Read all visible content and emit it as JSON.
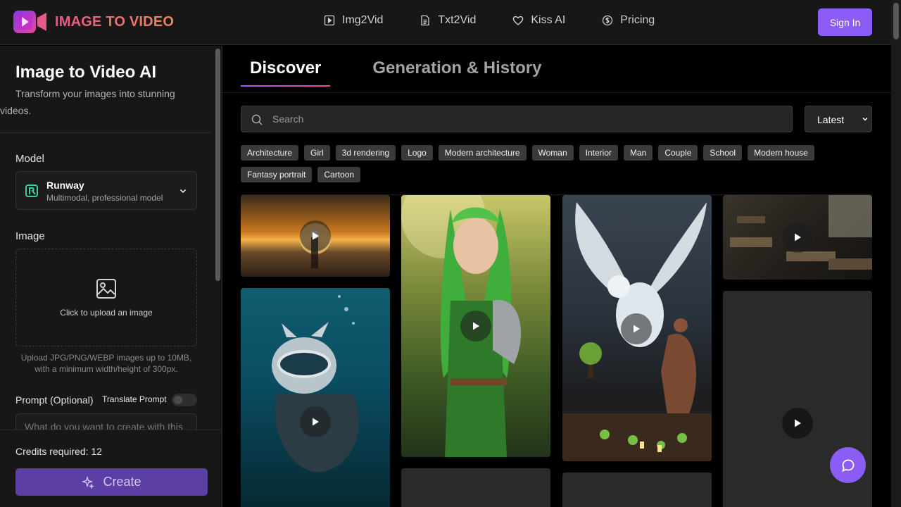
{
  "header": {
    "brand": "IMAGE TO VIDEO",
    "nav": [
      {
        "label": "Img2Vid",
        "icon": "video-icon"
      },
      {
        "label": "Txt2Vid",
        "icon": "document-icon"
      },
      {
        "label": "Kiss AI",
        "icon": "heart-icon"
      },
      {
        "label": "Pricing",
        "icon": "coin-icon"
      }
    ],
    "sign_in": "Sign In"
  },
  "sidebar": {
    "title": "Image to Video AI",
    "description_line1": "Transform your images into stunning",
    "description_line2": "videos.",
    "model_label": "Model",
    "model": {
      "name": "Runway",
      "subtitle": "Multimodal, professional model"
    },
    "image_label": "Image",
    "upload_text": "Click to upload an image",
    "upload_note": "Upload JPG/PNG/WEBP images up to 10MB, with a minimum width/height of 300px.",
    "prompt_label": "Prompt (Optional)",
    "translate_label": "Translate Prompt",
    "translate_enabled": false,
    "prompt_placeholder": "What do you want to create with this image?",
    "credits_text": "Credits required: 12",
    "create_label": "Create"
  },
  "main": {
    "tabs": [
      {
        "label": "Discover",
        "active": true
      },
      {
        "label": "Generation & History",
        "active": false
      }
    ],
    "search_placeholder": "Search",
    "sort_value": "Latest",
    "tags": [
      "Architecture",
      "Girl",
      "3d rendering",
      "Logo",
      "Modern architecture",
      "Woman",
      "Interior",
      "Man",
      "Couple",
      "School",
      "Modern house",
      "Fantasy portrait",
      "Cartoon"
    ],
    "gallery": [
      {
        "subject": "desert-sunset-traveler",
        "has_play": true
      },
      {
        "subject": "diver-cat-underwater",
        "has_play": true
      },
      {
        "subject": "green-haired-elf-warrior",
        "has_play": true
      },
      {
        "subject": "white-eagle-and-warrior-with-tree",
        "has_play": true
      },
      {
        "subject": "abandoned-classroom",
        "has_play": true
      },
      {
        "subject": "loading-placeholder",
        "has_play": true
      },
      {
        "subject": "loading-placeholder",
        "has_play": false
      },
      {
        "subject": "loading-placeholder",
        "has_play": false
      }
    ]
  },
  "colors": {
    "accent": "#8b5cf6",
    "create_button": "#5b3fa5",
    "header_bg": "#171717",
    "main_bg": "#000000"
  }
}
